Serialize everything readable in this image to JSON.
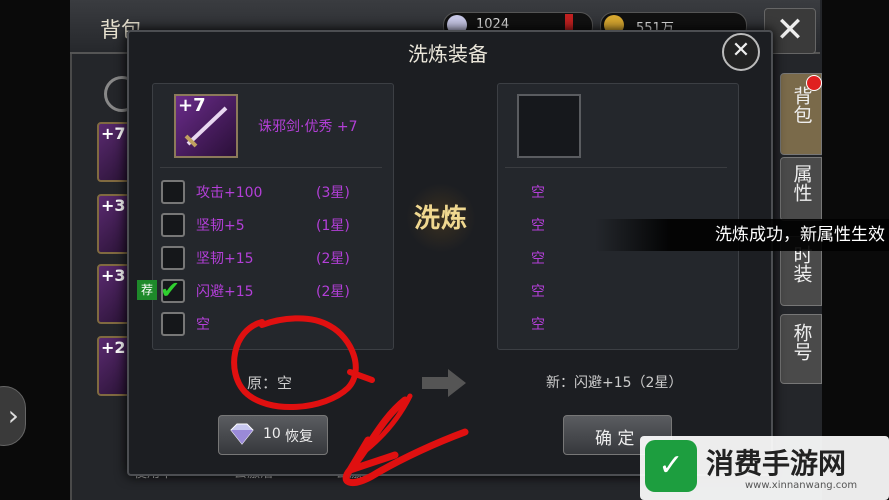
{
  "bag": {
    "title": "背包",
    "resource1_value": "1024",
    "resource2_value": "551万",
    "close_symbol": "✕",
    "slots": [
      "+7",
      "+3",
      "+3",
      "+2"
    ],
    "bottom_tabs": [
      "使用中",
      "去激活",
      "去激活"
    ]
  },
  "dialog": {
    "title": "洗炼装备",
    "close_symbol": "✕",
    "item": {
      "level": "+7",
      "name": "诛邪剑·优秀 +7"
    },
    "old_attributes": [
      {
        "text": "攻击+100",
        "stars": "(3星)",
        "checked": false
      },
      {
        "text": "坚韧+5",
        "stars": "(1星)",
        "checked": false
      },
      {
        "text": "坚韧+15",
        "stars": "(2星)",
        "checked": false
      },
      {
        "text": "闪避+15",
        "stars": "(2星)",
        "checked": true
      },
      {
        "text": "空",
        "stars": "",
        "checked": false
      }
    ],
    "recommend_tag": "荐",
    "new_attributes": [
      "空",
      "空",
      "空",
      "空",
      "空"
    ],
    "wash_label": "洗炼",
    "old_label": "原：空",
    "new_label": "新：闪避+15（2星）",
    "restore_cost": "10",
    "restore_label": "恢复",
    "confirm_label": "确 定"
  },
  "side_tabs": [
    "背包",
    "属性",
    "时装",
    "称号"
  ],
  "toast": "洗炼成功，新属性生效",
  "nav_symbol": "›",
  "watermark": {
    "logo_glyph": "✓",
    "title": "消费手游网",
    "url": "www.xinnanwang.com"
  },
  "colors": {
    "attribute": "#b33fd8",
    "check": "#2fd02f",
    "annotation": "#e01010"
  }
}
